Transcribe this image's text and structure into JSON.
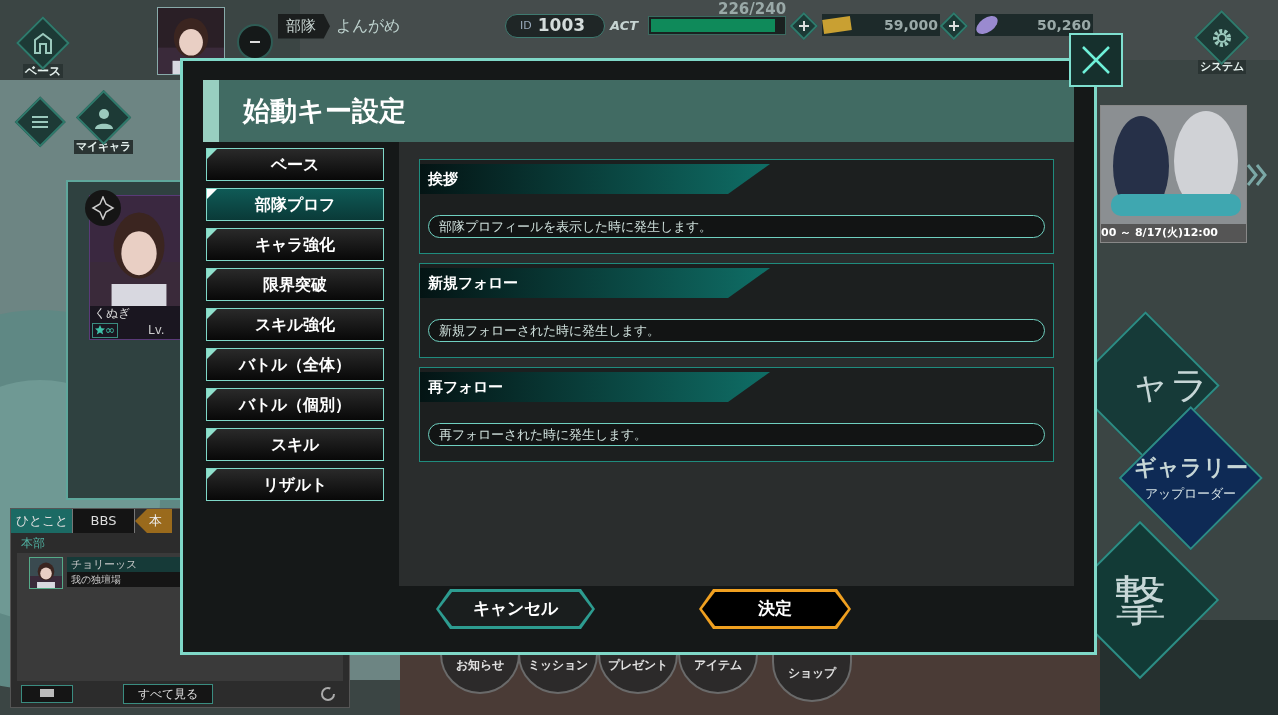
{
  "hud": {
    "base_label": "ベース",
    "my_chara_label": "マイキャラ",
    "unit_label": "部隊",
    "unit_name": "よんがめ",
    "id_label": "ID",
    "id": "1003",
    "act_label": "ACT",
    "act_reading": "226/240",
    "act_bar": {
      "level": 0.94
    },
    "ticket_count": "59,000",
    "gem_count": "50,260",
    "system_label": "システム"
  },
  "banner": {
    "period": "00 ～ 8/17(火)12:00"
  },
  "side_buttons": [
    {
      "label": "ャラ",
      "kind": "chara"
    },
    {
      "label": "ギャラリー",
      "sub": "アップローダー",
      "kind": "gallery"
    },
    {
      "label": "撃",
      "kind": "sortie"
    }
  ],
  "character_card": {
    "name": "くぬぎ",
    "rank": "∞",
    "level_label": "Lv."
  },
  "chat": {
    "tabs": [
      {
        "label": "ひとこと",
        "selected": true,
        "kind": "tab"
      },
      {
        "label": "BBS",
        "selected": false,
        "kind": "tab"
      },
      {
        "label": "本",
        "selected": false,
        "kind": "channel"
      }
    ],
    "channel": "本部",
    "messages": [
      {
        "user": "チョリーッス",
        "text": "我の独壇場"
      }
    ],
    "view_all": "すべて見る"
  },
  "bottom_nav": [
    "お知らせ",
    "ミッション",
    "プレゼント",
    "アイテム",
    "ショップ"
  ],
  "dialog": {
    "title": "始動キー設定",
    "categories": [
      {
        "label": "ベース",
        "selected": false
      },
      {
        "label": "部隊プロフ",
        "selected": true
      },
      {
        "label": "キャラ強化",
        "selected": false
      },
      {
        "label": "限界突破",
        "selected": false
      },
      {
        "label": "スキル強化",
        "selected": false
      },
      {
        "label": "バトル（全体）",
        "selected": false
      },
      {
        "label": "バトル（個別）",
        "selected": false
      },
      {
        "label": "スキル",
        "selected": false
      },
      {
        "label": "リザルト",
        "selected": false
      }
    ],
    "entries": [
      {
        "title": "挨拶",
        "description": "部隊プロフィールを表示した時に発生します。"
      },
      {
        "title": "新規フォロー",
        "description": "新規フォローされた時に発生します。"
      },
      {
        "title": "再フォロー",
        "description": "再フォローされた時に発生します。"
      }
    ],
    "buttons": [
      {
        "label": "キャンセル",
        "kind": "secondary"
      },
      {
        "label": "決定",
        "kind": "primary"
      }
    ]
  }
}
